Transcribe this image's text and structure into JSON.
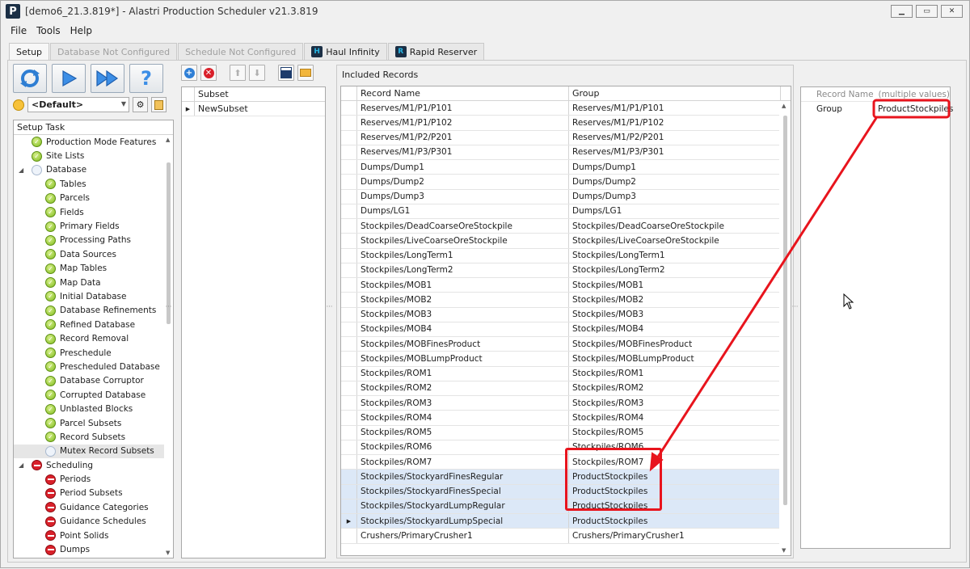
{
  "window": {
    "title": "[demo6_21.3.819*] - Alastri Production Scheduler v21.3.819",
    "app_icon_letter": "P"
  },
  "menu": [
    "File",
    "Tools",
    "Help"
  ],
  "tabs": [
    {
      "label": "Setup",
      "state": "active"
    },
    {
      "label": "Database Not Configured",
      "state": "disabled"
    },
    {
      "label": "Schedule Not Configured",
      "state": "disabled"
    },
    {
      "label": "Haul Infinity",
      "state": "normal",
      "icon": "haul-infinity-icon"
    },
    {
      "label": "Rapid Reserver",
      "state": "normal",
      "icon": "rapid-reserver-icon"
    }
  ],
  "left": {
    "profile": "<Default>",
    "task_header": "Setup Task",
    "tasks": [
      {
        "label": "Production Mode Features",
        "status": "ok",
        "level": 1
      },
      {
        "label": "Site Lists",
        "status": "ok",
        "level": 1
      },
      {
        "label": "Database",
        "status": "pending",
        "level": 0,
        "expanded": true
      },
      {
        "label": "Tables",
        "status": "ok",
        "level": 2
      },
      {
        "label": "Parcels",
        "status": "ok",
        "level": 2
      },
      {
        "label": "Fields",
        "status": "ok",
        "level": 2
      },
      {
        "label": "Primary Fields",
        "status": "ok",
        "level": 2
      },
      {
        "label": "Processing Paths",
        "status": "ok",
        "level": 2
      },
      {
        "label": "Data Sources",
        "status": "ok",
        "level": 2
      },
      {
        "label": "Map Tables",
        "status": "ok",
        "level": 2
      },
      {
        "label": "Map Data",
        "status": "ok",
        "level": 2
      },
      {
        "label": "Initial Database",
        "status": "ok",
        "level": 2
      },
      {
        "label": "Database Refinements",
        "status": "ok",
        "level": 2
      },
      {
        "label": "Refined Database",
        "status": "ok",
        "level": 2
      },
      {
        "label": "Record Removal",
        "status": "ok",
        "level": 2
      },
      {
        "label": "Preschedule",
        "status": "ok",
        "level": 2
      },
      {
        "label": "Prescheduled Database",
        "status": "ok",
        "level": 2
      },
      {
        "label": "Database Corruptor",
        "status": "ok",
        "level": 2
      },
      {
        "label": "Corrupted Database",
        "status": "ok",
        "level": 2
      },
      {
        "label": "Unblasted Blocks",
        "status": "ok",
        "level": 2
      },
      {
        "label": "Parcel Subsets",
        "status": "ok",
        "level": 2
      },
      {
        "label": "Record Subsets",
        "status": "ok",
        "level": 2
      },
      {
        "label": "Mutex Record Subsets",
        "status": "pending",
        "level": 2,
        "selected": true
      },
      {
        "label": "Scheduling",
        "status": "error",
        "level": 0,
        "expanded": true
      },
      {
        "label": "Periods",
        "status": "error",
        "level": 2
      },
      {
        "label": "Period Subsets",
        "status": "error",
        "level": 2
      },
      {
        "label": "Guidance Categories",
        "status": "error",
        "level": 2
      },
      {
        "label": "Guidance Schedules",
        "status": "error",
        "level": 2
      },
      {
        "label": "Point Solids",
        "status": "error",
        "level": 2
      },
      {
        "label": "Dumps",
        "status": "error",
        "level": 2
      }
    ]
  },
  "subset": {
    "header": "Subset",
    "rows": [
      "NewSubset"
    ]
  },
  "records": {
    "panel_title": "Included Records",
    "col_name": "Record Name",
    "col_group": "Group",
    "rows": [
      {
        "name": "Reserves/M1/P1/P101",
        "group": "Reserves/M1/P1/P101"
      },
      {
        "name": "Reserves/M1/P1/P102",
        "group": "Reserves/M1/P1/P102"
      },
      {
        "name": "Reserves/M1/P2/P201",
        "group": "Reserves/M1/P2/P201"
      },
      {
        "name": "Reserves/M1/P3/P301",
        "group": "Reserves/M1/P3/P301"
      },
      {
        "name": "Dumps/Dump1",
        "group": "Dumps/Dump1"
      },
      {
        "name": "Dumps/Dump2",
        "group": "Dumps/Dump2"
      },
      {
        "name": "Dumps/Dump3",
        "group": "Dumps/Dump3"
      },
      {
        "name": "Dumps/LG1",
        "group": "Dumps/LG1"
      },
      {
        "name": "Stockpiles/DeadCoarseOreStockpile",
        "group": "Stockpiles/DeadCoarseOreStockpile"
      },
      {
        "name": "Stockpiles/LiveCoarseOreStockpile",
        "group": "Stockpiles/LiveCoarseOreStockpile"
      },
      {
        "name": "Stockpiles/LongTerm1",
        "group": "Stockpiles/LongTerm1"
      },
      {
        "name": "Stockpiles/LongTerm2",
        "group": "Stockpiles/LongTerm2"
      },
      {
        "name": "Stockpiles/MOB1",
        "group": "Stockpiles/MOB1"
      },
      {
        "name": "Stockpiles/MOB2",
        "group": "Stockpiles/MOB2"
      },
      {
        "name": "Stockpiles/MOB3",
        "group": "Stockpiles/MOB3"
      },
      {
        "name": "Stockpiles/MOB4",
        "group": "Stockpiles/MOB4"
      },
      {
        "name": "Stockpiles/MOBFinesProduct",
        "group": "Stockpiles/MOBFinesProduct"
      },
      {
        "name": "Stockpiles/MOBLumpProduct",
        "group": "Stockpiles/MOBLumpProduct"
      },
      {
        "name": "Stockpiles/ROM1",
        "group": "Stockpiles/ROM1"
      },
      {
        "name": "Stockpiles/ROM2",
        "group": "Stockpiles/ROM2"
      },
      {
        "name": "Stockpiles/ROM3",
        "group": "Stockpiles/ROM3"
      },
      {
        "name": "Stockpiles/ROM4",
        "group": "Stockpiles/ROM4"
      },
      {
        "name": "Stockpiles/ROM5",
        "group": "Stockpiles/ROM5"
      },
      {
        "name": "Stockpiles/ROM6",
        "group": "Stockpiles/ROM6"
      },
      {
        "name": "Stockpiles/ROM7",
        "group": "Stockpiles/ROM7"
      },
      {
        "name": "Stockpiles/StockyardFinesRegular",
        "group": "ProductStockpiles",
        "highlight": true
      },
      {
        "name": "Stockpiles/StockyardFinesSpecial",
        "group": "ProductStockpiles",
        "highlight": true
      },
      {
        "name": "Stockpiles/StockyardLumpRegular",
        "group": "ProductStockpiles",
        "highlight": true
      },
      {
        "name": "Stockpiles/StockyardLumpSpecial",
        "group": "ProductStockpiles",
        "highlight": true,
        "current": true
      },
      {
        "name": "Crushers/PrimaryCrusher1",
        "group": "Crushers/PrimaryCrusher1"
      }
    ]
  },
  "properties": {
    "col_name": "Record Name",
    "col_value": "(multiple values)",
    "rows": [
      {
        "name": "Group",
        "value": "ProductStockpiles"
      }
    ]
  },
  "colors": {
    "annotation_red": "#e8141d",
    "selection_blue": "#dce8f7",
    "ok_green": "#7fbb1d",
    "error_red": "#d9202a"
  }
}
